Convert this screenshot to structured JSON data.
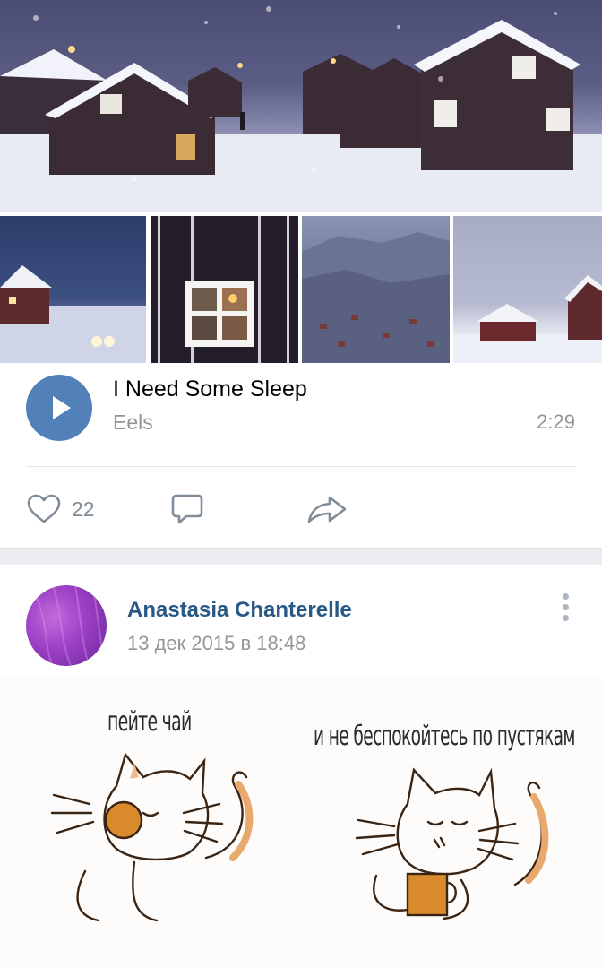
{
  "audio": {
    "title": "I Need Some Sleep",
    "artist": "Eels",
    "duration": "2:29"
  },
  "actions": {
    "likes": "22"
  },
  "post": {
    "author": "Anastasia Chanterelle",
    "date": "13 дек 2015 в 18:48",
    "image_text_left": "пейте чай",
    "image_text_right": "и не беспокойтесь по пустякам"
  },
  "colors": {
    "play_button": "#5181b8",
    "author_link": "#2a5885",
    "secondary_text": "#939699"
  }
}
